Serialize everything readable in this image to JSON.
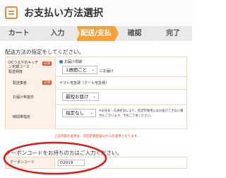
{
  "page": {
    "title": "お支払い方法選択"
  },
  "steps": [
    {
      "label": "カート",
      "active": false
    },
    {
      "label": "入力",
      "active": false
    },
    {
      "label": "配送/支払",
      "active": true
    },
    {
      "label": "確認",
      "active": false
    },
    {
      "label": "完了",
      "active": false
    }
  ],
  "delivery": {
    "instruction": "配送方法の指定をしてください。",
    "rows": [
      {
        "label_line1": "DCつるやおキッチン定期コース",
        "label_line2": "配送頻度",
        "required_badge": "必須",
        "radio_label": "お届け周期",
        "select_value": "1週間ごと",
        "suffix": "にお届け"
      },
      {
        "label": "配送業者",
        "required_badge": "必須",
        "value": "ヤマト宅急便（クール宅急便）"
      },
      {
        "label": "お届け希望日",
        "select_value": "最短お届け"
      },
      {
        "label": "時間帯指定",
        "select_value": "指定なし",
        "note": "※お天気・交通状況により、指定時間帯にはお届けできない場合もございます。予めご了承ください。"
      }
    ]
  },
  "notice": "上記内容の変更は、次回定期配送分からの変更となります。",
  "coupon": {
    "title": "クーポンコードをお持ちの方はご入力ください。",
    "label": "クーポンコード",
    "value": "D2019"
  },
  "annotation": {
    "circle_color": "#e01818"
  }
}
